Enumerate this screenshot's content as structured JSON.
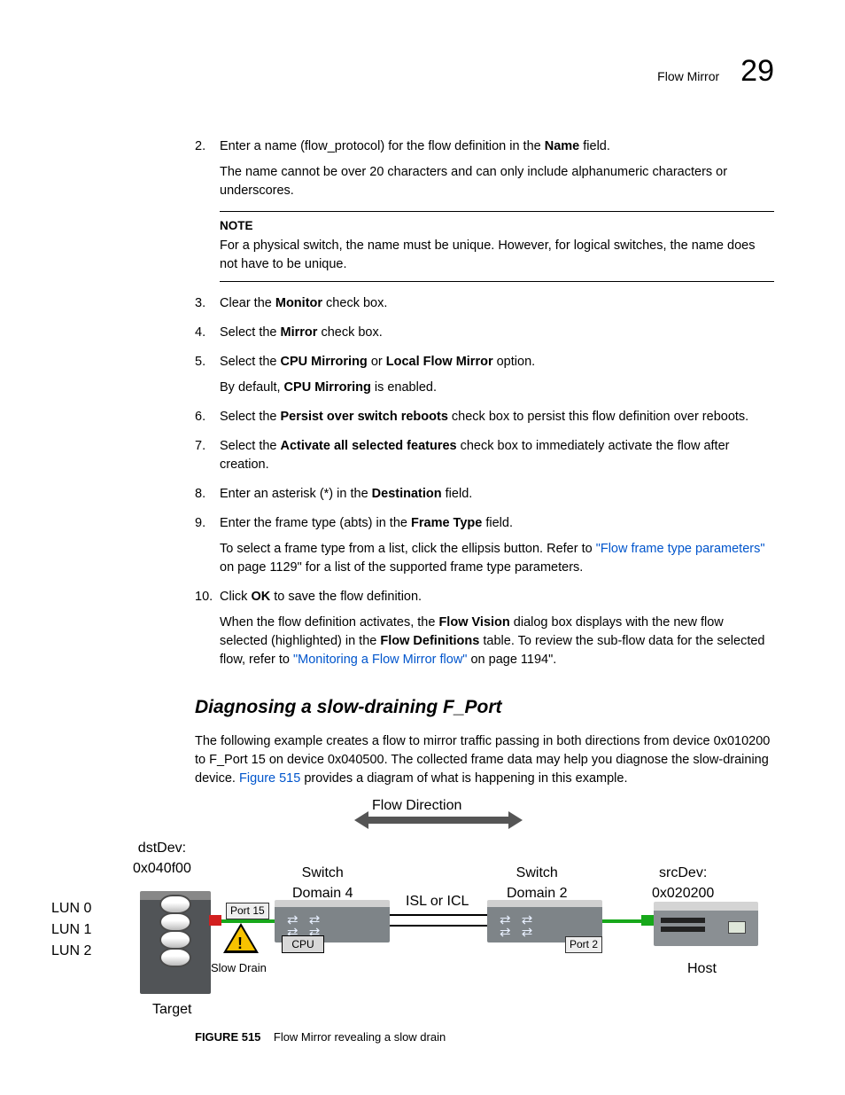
{
  "header": {
    "section": "Flow Mirror",
    "chapter_num": "29"
  },
  "steps": [
    {
      "n": "2.",
      "main": "Enter a name (flow_protocol) for the flow definition in the ",
      "bold1": "Name",
      "tail1": " field.",
      "extra": "The name cannot be over 20 characters and can only include alphanumeric characters or underscores."
    },
    {
      "n": "3.",
      "main": "Clear the ",
      "bold1": "Monitor",
      "tail1": " check box."
    },
    {
      "n": "4.",
      "main": "Select the ",
      "bold1": "Mirror",
      "tail1": " check box."
    },
    {
      "n": "5.",
      "main": "Select the ",
      "bold1": "CPU Mirroring",
      "mid": " or ",
      "bold2": "Local Flow Mirror",
      "tail1": " option.",
      "extra_pre": "By default, ",
      "extra_bold": "CPU Mirroring",
      "extra_post": " is enabled."
    },
    {
      "n": "6.",
      "main": "Select the ",
      "bold1": "Persist over switch reboots",
      "tail1": " check box to persist this flow definition over reboots."
    },
    {
      "n": "7.",
      "main": "Select the ",
      "bold1": "Activate all selected features",
      "tail1": " check box to immediately activate the flow after creation."
    },
    {
      "n": "8.",
      "main": "Enter an asterisk (*) in the ",
      "bold1": "Destination",
      "tail1": " field."
    },
    {
      "n": "9.",
      "main": "Enter the frame type (abts) in the ",
      "bold1": "Frame Type",
      "tail1": " field.",
      "extra_pretext": "To select a frame type from a list, click the ellipsis button. Refer to ",
      "extra_link": "\"Flow frame type parameters\"",
      "extra_posttext": " on page 1129\" for a list of the supported frame type parameters."
    },
    {
      "n": "10.",
      "main": "Click ",
      "bold1": "OK",
      "tail1": " to save the flow definition.",
      "extra_pretext2": "When the flow definition activates, the ",
      "extra_bold2a": "Flow Vision",
      "extra_mid2": " dialog box displays with the new flow selected (highlighted) in the ",
      "extra_bold2b": "Flow Definitions",
      "extra_mid2b": " table. To review the sub-flow data for the selected flow, refer to ",
      "extra_link2": "\"Monitoring a Flow Mirror flow\"",
      "extra_post2": " on page 1194\"."
    }
  ],
  "note": {
    "label": "NOTE",
    "text": "For a physical switch, the name must be unique. However, for logical switches, the name does not have to be unique."
  },
  "subheading": "Diagnosing a slow-draining F_Port",
  "intro": {
    "pre": "The following example creates a flow to mirror traffic passing in both directions from device 0x010200 to F_Port 15 on device 0x040500. The collected frame data may help you diagnose the slow-draining device. ",
    "link": "Figure 515",
    "post": " provides a diagram of what is happening in this example."
  },
  "figure": {
    "flow_direction": "Flow Direction",
    "dstDev_lbl": "dstDev:",
    "dstDev_val": "0x040f00",
    "lun0": "LUN 0",
    "lun1": "LUN 1",
    "lun2": "LUN 2",
    "target": "Target",
    "slow_drain": "Slow Drain",
    "port15": "Port 15",
    "cpu": "CPU",
    "switch_d4a": "Switch",
    "switch_d4b": "Domain 4",
    "isl": "ISL or ICL",
    "switch_d2a": "Switch",
    "switch_d2b": "Domain 2",
    "port2": "Port 2",
    "srcDev_lbl": "srcDev:",
    "srcDev_val": "0x020200",
    "host": "Host"
  },
  "caption": {
    "label": "FIGURE 515",
    "text": "Flow Mirror revealing a slow drain"
  }
}
